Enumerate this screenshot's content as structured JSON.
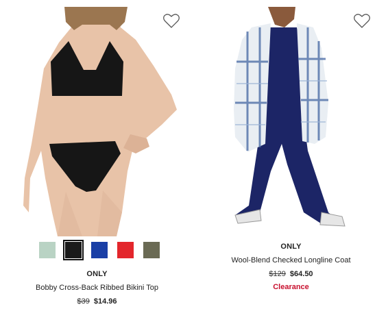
{
  "products": [
    {
      "brand": "ONLY",
      "name": "Bobby Cross-Back Ribbed Bikini Top",
      "original_price": "$39",
      "sale_price": "$14.96",
      "wishlist_icon": "heart-outline-icon",
      "swatches": [
        {
          "color": "#b9d3c4",
          "selected": false
        },
        {
          "color": "#1a1a1a",
          "selected": true
        },
        {
          "color": "#1a3fa6",
          "selected": false
        },
        {
          "color": "#e3262c",
          "selected": false
        },
        {
          "color": "#6a6a54",
          "selected": false
        }
      ]
    },
    {
      "brand": "ONLY",
      "name": "Wool-Blend Checked Longline Coat",
      "original_price": "$129",
      "sale_price": "$64.50",
      "badge": "Clearance",
      "wishlist_icon": "heart-outline-icon"
    }
  ],
  "colors": {
    "clearance": "#c8102e",
    "text": "#222222"
  }
}
